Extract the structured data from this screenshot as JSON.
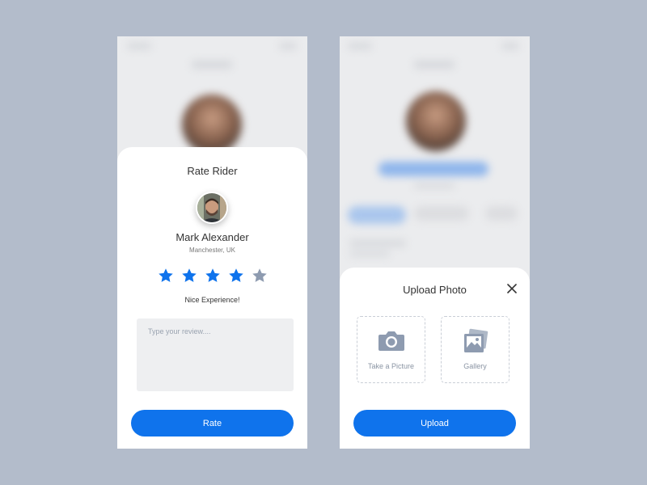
{
  "rate_rider": {
    "title": "Rate Rider",
    "rider_name": "Mark Alexander",
    "rider_location": "Manchester, UK",
    "rating": 4,
    "max_rating": 5,
    "rating_text": "Nice Experience!",
    "review_placeholder": "Type your review....",
    "submit_label": "Rate"
  },
  "upload_photo": {
    "title": "Upload Photo",
    "options": [
      {
        "label": "Take a Picture",
        "icon": "camera-icon"
      },
      {
        "label": "Gallery",
        "icon": "gallery-icon"
      }
    ],
    "submit_label": "Upload"
  },
  "colors": {
    "page_background": "#b3bccb",
    "accent": "#0f73ec",
    "star_active": "#0f73ec",
    "star_inactive": "#8e9bb0",
    "icon_muted": "#8e9bb0"
  }
}
